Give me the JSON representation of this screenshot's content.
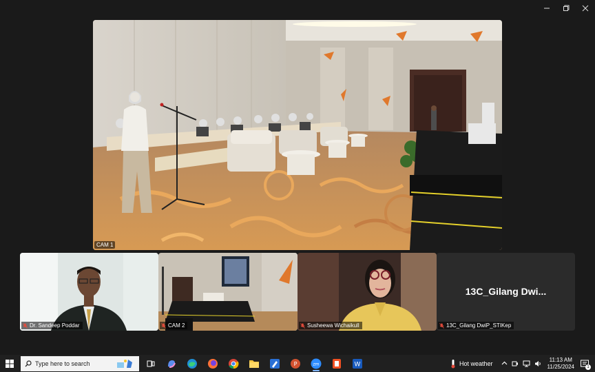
{
  "window": {
    "minimize": "minimize",
    "maximize": "maximize",
    "close": "close"
  },
  "main_video": {
    "label": "CAM 1"
  },
  "tiles": [
    {
      "name": "Dr. Sandeep Poddar",
      "muted": true
    },
    {
      "name": "CAM 2",
      "muted": true
    },
    {
      "name": "Susheewa Wichaikull",
      "muted": true
    },
    {
      "name": "13C_Gilang DwiP_STIKep",
      "display_name": "13C_Gilang  Dwi...",
      "muted": true
    }
  ],
  "taskbar": {
    "search_placeholder": "Type here to search",
    "weather": "Hot weather",
    "time": "11:13 AM",
    "date": "11/25/2024",
    "notifications": "1"
  },
  "colors": {
    "taskbar": "#202020",
    "background": "#1a1a1a",
    "tile_dark": "#2b2b2b"
  }
}
